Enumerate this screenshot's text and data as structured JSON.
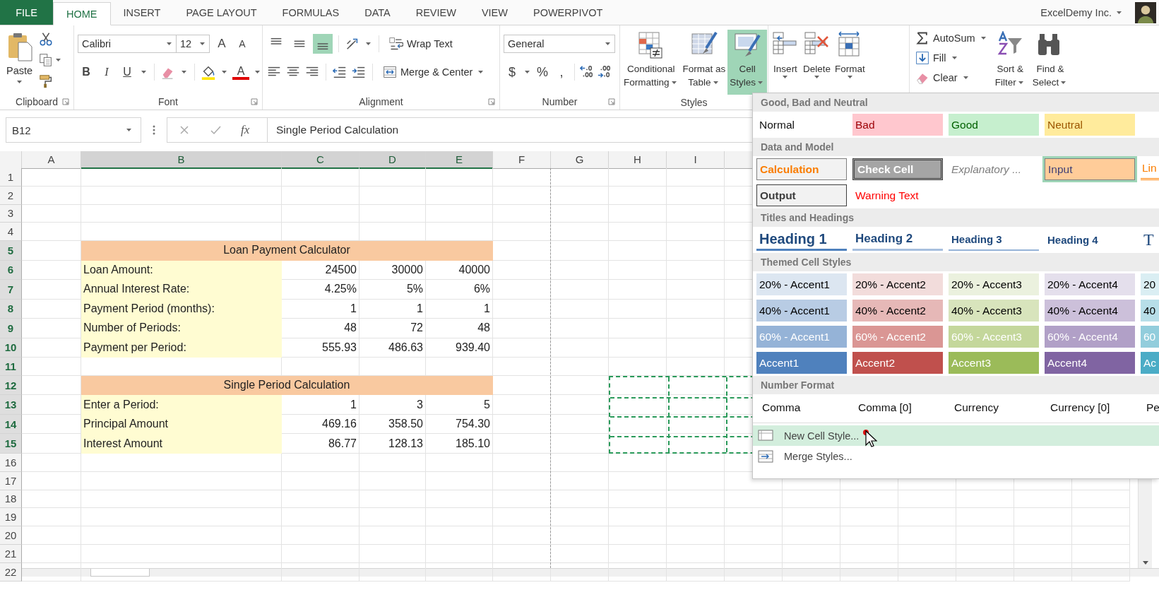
{
  "tabs": [
    {
      "label": "FILE",
      "kind": "file",
      "selected": false
    },
    {
      "label": "HOME",
      "kind": "tab",
      "selected": true
    },
    {
      "label": "INSERT",
      "kind": "tab",
      "selected": false
    },
    {
      "label": "PAGE LAYOUT",
      "kind": "tab",
      "selected": false
    },
    {
      "label": "FORMULAS",
      "kind": "tab",
      "selected": false
    },
    {
      "label": "DATA",
      "kind": "tab",
      "selected": false
    },
    {
      "label": "REVIEW",
      "kind": "tab",
      "selected": false
    },
    {
      "label": "VIEW",
      "kind": "tab",
      "selected": false
    },
    {
      "label": "POWERPIVOT",
      "kind": "tab",
      "selected": false
    }
  ],
  "account": {
    "name": "ExcelDemy Inc."
  },
  "ribbon": {
    "groups": [
      {
        "kind": "clipboard",
        "label": "Clipboard",
        "paste": "Paste"
      },
      {
        "kind": "font",
        "label": "Font",
        "font_name": "Calibri",
        "font_size": "12",
        "grow": "A",
        "shrink": "A",
        "bold": "B",
        "italic": "I",
        "underline": "U",
        "font_color": "A"
      },
      {
        "kind": "alignment",
        "label": "Alignment",
        "wrap_text": "Wrap Text",
        "merge": "Merge & Center",
        "vertical": [
          {
            "kind": "top",
            "selected": false
          },
          {
            "kind": "middle",
            "selected": false
          },
          {
            "kind": "bottom",
            "selected": true
          }
        ]
      },
      {
        "kind": "number",
        "label": "Number",
        "format": "General",
        "currency": "$",
        "percent": "%",
        "comma": ","
      },
      {
        "kind": "styles",
        "label": "Styles",
        "buttons": [
          {
            "kind": "conditional",
            "lines": [
              "Conditional",
              "Formatting"
            ],
            "selected": false
          },
          {
            "kind": "table",
            "lines": [
              "Format as",
              "Table"
            ],
            "selected": false
          },
          {
            "kind": "cellstyles",
            "lines": [
              "Cell",
              "Styles"
            ],
            "selected": true
          }
        ]
      },
      {
        "kind": "cells",
        "buttons": [
          {
            "kind": "insert",
            "label": "Insert"
          },
          {
            "kind": "delete",
            "label": "Delete"
          },
          {
            "kind": "format",
            "label": "Format"
          }
        ]
      },
      {
        "kind": "editing",
        "autosum": "AutoSum",
        "fill": "Fill",
        "clear": "Clear",
        "buttons": [
          {
            "kind": "sort",
            "lines": [
              "Sort &",
              "Filter"
            ]
          },
          {
            "kind": "find",
            "lines": [
              "Find &",
              "Select"
            ]
          }
        ]
      }
    ]
  },
  "formula_bar": {
    "name_box": "B12",
    "function_label": "fx",
    "formula": "Single Period Calculation"
  },
  "sheet": {
    "columns": [
      {
        "label": "A",
        "selected": false,
        "copied": false,
        "page_break": false
      },
      {
        "label": "B",
        "selected": true,
        "copied": false,
        "page_break": false
      },
      {
        "label": "C",
        "selected": true,
        "copied": false,
        "page_break": false
      },
      {
        "label": "D",
        "selected": true,
        "copied": false,
        "page_break": false
      },
      {
        "label": "E",
        "selected": true,
        "copied": false,
        "page_break": false
      },
      {
        "label": "F",
        "selected": false,
        "copied": false,
        "page_break": true
      },
      {
        "label": "G",
        "selected": false,
        "copied": false,
        "page_break": false
      },
      {
        "label": "H",
        "selected": false,
        "copied": true,
        "page_break": false
      },
      {
        "label": "I",
        "selected": false,
        "copied": true,
        "page_break": false
      }
    ],
    "rows": [
      {
        "label": "1",
        "kind": "empty",
        "selected": false,
        "copied": false
      },
      {
        "label": "2",
        "kind": "empty",
        "selected": false,
        "copied": false
      },
      {
        "label": "3",
        "kind": "empty",
        "selected": false,
        "copied": false
      },
      {
        "label": "4",
        "kind": "empty",
        "selected": false,
        "copied": false
      },
      {
        "label": "5",
        "kind": "title",
        "selected": true,
        "copied": false,
        "text": "Loan Payment Calculator"
      },
      {
        "label": "6",
        "kind": "data",
        "selected": true,
        "copied": false,
        "text": "Loan Amount:",
        "values": [
          "24500",
          "30000",
          "40000"
        ]
      },
      {
        "label": "7",
        "kind": "data",
        "selected": true,
        "copied": false,
        "text": "Annual Interest Rate:",
        "values": [
          "4.25%",
          "5%",
          "6%"
        ]
      },
      {
        "label": "8",
        "kind": "data",
        "selected": true,
        "copied": false,
        "text": "Payment Period (months):",
        "values": [
          "1",
          "1",
          "1"
        ]
      },
      {
        "label": "9",
        "kind": "data",
        "selected": true,
        "copied": false,
        "text": "Number of Periods:",
        "values": [
          "48",
          "72",
          "48"
        ]
      },
      {
        "label": "10",
        "kind": "data",
        "selected": true,
        "copied": false,
        "text": "Payment per Period:",
        "values": [
          "555.93",
          "486.63",
          "939.40"
        ]
      },
      {
        "label": "11",
        "kind": "empty",
        "selected": true,
        "copied": false
      },
      {
        "label": "12",
        "kind": "title",
        "selected": true,
        "copied": true,
        "text": "Single Period Calculation"
      },
      {
        "label": "13",
        "kind": "data",
        "selected": true,
        "copied": true,
        "text": "Enter a Period:",
        "values": [
          "1",
          "3",
          "5"
        ]
      },
      {
        "label": "14",
        "kind": "data",
        "selected": true,
        "copied": true,
        "text": "Principal Amount",
        "values": [
          "469.16",
          "358.50",
          "754.30"
        ]
      },
      {
        "label": "15",
        "kind": "data",
        "selected": true,
        "copied": true,
        "text": "Interest Amount",
        "values": [
          "86.77",
          "128.13",
          "185.10"
        ]
      },
      {
        "label": "16",
        "kind": "empty",
        "selected": false,
        "copied": false
      },
      {
        "label": "17",
        "kind": "empty",
        "selected": false,
        "copied": false
      },
      {
        "label": "18",
        "kind": "empty",
        "selected": false,
        "copied": false
      },
      {
        "label": "19",
        "kind": "empty",
        "selected": false,
        "copied": false
      },
      {
        "label": "20",
        "kind": "empty",
        "selected": false,
        "copied": false
      },
      {
        "label": "21",
        "kind": "empty",
        "selected": false,
        "copied": false
      },
      {
        "label": "22",
        "kind": "empty",
        "selected": false,
        "copied": false
      }
    ]
  },
  "cell_styles_menu": {
    "sections": [
      {
        "title": "Good, Bad and Neutral",
        "rows": [
          [
            {
              "text": "Normal",
              "kind": "normal",
              "selected": false
            },
            {
              "text": "Bad",
              "kind": "bad",
              "selected": false
            },
            {
              "text": "Good",
              "kind": "good",
              "selected": false
            },
            {
              "text": "Neutral",
              "kind": "neutral",
              "selected": false
            }
          ]
        ]
      },
      {
        "title": "Data and Model",
        "rows": [
          [
            {
              "text": "Calculation",
              "kind": "calculation",
              "selected": false
            },
            {
              "text": "Check Cell",
              "kind": "check",
              "selected": false
            },
            {
              "text": "Explanatory ...",
              "kind": "explanatory",
              "selected": false
            },
            {
              "text": "Input",
              "kind": "input",
              "selected": true
            },
            {
              "text": "Lin",
              "kind": "linked",
              "selected": false
            }
          ],
          [
            {
              "text": "Output",
              "kind": "output",
              "selected": false
            },
            {
              "text": "Warning Text",
              "kind": "warning",
              "selected": false
            }
          ]
        ]
      },
      {
        "title": "Titles and Headings",
        "rows": [
          [
            {
              "text": "Heading 1",
              "kind": "h1",
              "selected": false
            },
            {
              "text": "Heading 2",
              "kind": "h2",
              "selected": false
            },
            {
              "text": "Heading 3",
              "kind": "h3",
              "selected": false
            },
            {
              "text": "Heading 4",
              "kind": "h4",
              "selected": false
            },
            {
              "text": "T",
              "kind": "title",
              "selected": false
            }
          ]
        ]
      },
      {
        "title": "Themed Cell Styles",
        "rows": [
          [
            {
              "text": "20% - Accent1",
              "kind": "accent20",
              "color": "#dce6f1",
              "selected": false
            },
            {
              "text": "20% - Accent2",
              "kind": "accent20",
              "color": "#f2dcdb",
              "selected": false
            },
            {
              "text": "20% - Accent3",
              "kind": "accent20",
              "color": "#ebf1de",
              "selected": false
            },
            {
              "text": "20% - Accent4",
              "kind": "accent20",
              "color": "#e4dfec",
              "selected": false
            },
            {
              "text": "20",
              "kind": "accent20",
              "color": "#daeef3",
              "selected": false
            }
          ],
          [
            {
              "text": "40% - Accent1",
              "kind": "accent40",
              "color": "#b8cce4",
              "selected": false
            },
            {
              "text": "40% - Accent2",
              "kind": "accent40",
              "color": "#e6b8b7",
              "selected": false
            },
            {
              "text": "40% - Accent3",
              "kind": "accent40",
              "color": "#d8e4bc",
              "selected": false
            },
            {
              "text": "40% - Accent4",
              "kind": "accent40",
              "color": "#ccc0da",
              "selected": false
            },
            {
              "text": "40",
              "kind": "accent40",
              "color": "#b7dee8",
              "selected": false
            }
          ],
          [
            {
              "text": "60% - Accent1",
              "kind": "accent60",
              "color": "#95b3d7",
              "selected": false
            },
            {
              "text": "60% - Accent2",
              "kind": "accent60",
              "color": "#da9694",
              "selected": false
            },
            {
              "text": "60% - Accent3",
              "kind": "accent60",
              "color": "#c4d79b",
              "selected": false
            },
            {
              "text": "60% - Accent4",
              "kind": "accent60",
              "color": "#b1a0c7",
              "selected": false
            },
            {
              "text": "60",
              "kind": "accent60",
              "color": "#92cddc",
              "selected": false
            }
          ],
          [
            {
              "text": "Accent1",
              "kind": "accent",
              "color": "#4f81bd",
              "selected": false
            },
            {
              "text": "Accent2",
              "kind": "accent",
              "color": "#c0504d",
              "selected": false
            },
            {
              "text": "Accent3",
              "kind": "accent",
              "color": "#9bbb59",
              "selected": false
            },
            {
              "text": "Accent4",
              "kind": "accent",
              "color": "#8064a2",
              "selected": false
            },
            {
              "text": "Ac",
              "kind": "accent",
              "color": "#4bacc6",
              "selected": false
            }
          ]
        ]
      },
      {
        "title": "Number Format",
        "rows": [
          [
            {
              "text": "Comma",
              "kind": "plain",
              "selected": false
            },
            {
              "text": "Comma [0]",
              "kind": "plain",
              "selected": false
            },
            {
              "text": "Currency",
              "kind": "plain",
              "selected": false
            },
            {
              "text": "Currency [0]",
              "kind": "plain",
              "selected": false
            },
            {
              "text": "Pe",
              "kind": "plain",
              "selected": false
            }
          ]
        ]
      }
    ],
    "commands": [
      {
        "label": "New Cell Style...",
        "kind": "new",
        "selected": true
      },
      {
        "label": "Merge Styles...",
        "kind": "merge",
        "selected": false
      }
    ]
  }
}
